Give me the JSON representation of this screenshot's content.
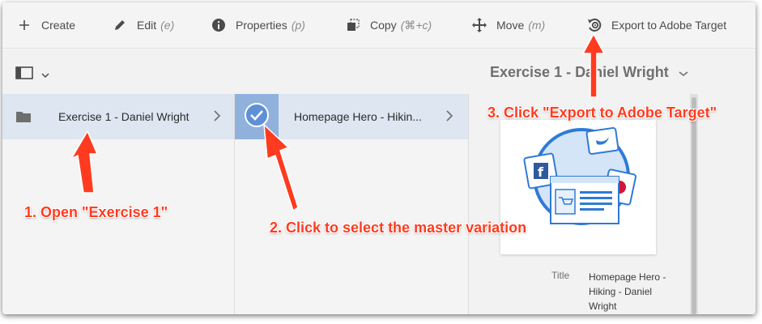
{
  "toolbar": {
    "create": {
      "label": "Create",
      "icon": "plus-icon"
    },
    "edit": {
      "label": "Edit",
      "shortcut": "(e)",
      "icon": "pencil-icon"
    },
    "properties": {
      "label": "Properties",
      "shortcut": "(p)",
      "icon": "info-icon"
    },
    "copy": {
      "label": "Copy",
      "shortcut": "(⌘+c)",
      "icon": "copy-icon"
    },
    "move": {
      "label": "Move",
      "shortcut": "(m)",
      "icon": "move-icon"
    },
    "export": {
      "label": "Export to Adobe Target",
      "icon": "export-target-icon"
    }
  },
  "header": {
    "title": "Exercise 1 - Daniel Wright"
  },
  "columns": {
    "col1": {
      "item_label": "Exercise 1 - Daniel Wright",
      "icon": "folder-icon"
    },
    "col2": {
      "item_label": "Homepage Hero - Hikin...",
      "icon": "checkmark-circle-icon"
    }
  },
  "details": {
    "title_key": "Title",
    "title_value": "Homepage Hero - Hiking - Daniel Wright"
  },
  "annotations": {
    "step1": "1. Open \"Exercise 1\"",
    "step2": "2. Click to select the master variation",
    "step3": "3. Click \"Export to Adobe Target\""
  },
  "colors": {
    "annotation": "#ff3b1f",
    "selected_row": "#dde6f1",
    "selected_thumb": "#8fb1dc"
  }
}
